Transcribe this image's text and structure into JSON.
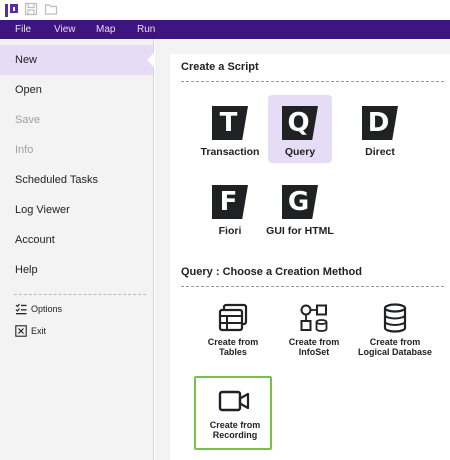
{
  "menubar": {
    "items": [
      "File",
      "View",
      "Map",
      "Run"
    ]
  },
  "sidebar": {
    "items": [
      {
        "label": "New",
        "state": "active"
      },
      {
        "label": "Open",
        "state": "normal"
      },
      {
        "label": "Save",
        "state": "disabled"
      },
      {
        "label": "Info",
        "state": "disabled"
      },
      {
        "label": "Scheduled Tasks",
        "state": "normal"
      },
      {
        "label": "Log Viewer",
        "state": "normal"
      },
      {
        "label": "Account",
        "state": "normal"
      },
      {
        "label": "Help",
        "state": "normal"
      }
    ],
    "options_label": "Options",
    "exit_label": "Exit"
  },
  "main": {
    "create_title": "Create a Script",
    "script_types": [
      {
        "letter": "T",
        "label": "Transaction"
      },
      {
        "letter": "Q",
        "label": "Query",
        "selected": true
      },
      {
        "letter": "D",
        "label": "Direct"
      },
      {
        "letter": "F",
        "label": "Fiori"
      },
      {
        "letter": "G",
        "label": "GUI for HTML"
      }
    ],
    "method_title": "Query :   Choose a Creation Method",
    "methods": [
      {
        "label": "Create from Tables",
        "icon": "tables-icon"
      },
      {
        "label": "Create from InfoSet",
        "icon": "infoset-icon"
      },
      {
        "label": "Create from Logical Database",
        "icon": "database-icon"
      },
      {
        "label": "Create from Recording",
        "icon": "video-camera-icon",
        "highlighted": true
      }
    ]
  },
  "colors": {
    "menubar": "#3d1480",
    "selected": "#e6dcf5",
    "highlight": "#7ac143",
    "badge": "#1f2123"
  }
}
